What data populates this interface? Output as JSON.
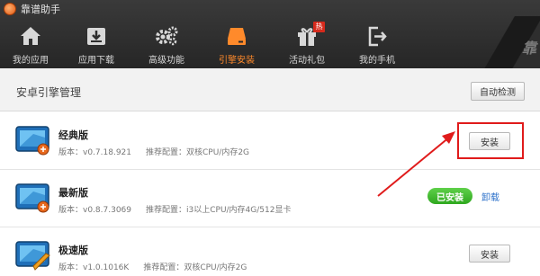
{
  "app": {
    "title": "靠谱助手",
    "corner_text": "靠"
  },
  "nav": {
    "items": [
      {
        "label": "我的应用",
        "icon": "home-icon"
      },
      {
        "label": "应用下载",
        "icon": "download-box-icon"
      },
      {
        "label": "高级功能",
        "icon": "gears-icon"
      },
      {
        "label": "引擎安装",
        "icon": "engine-disk-icon",
        "active": true
      },
      {
        "label": "活动礼包",
        "icon": "gift-icon",
        "badge": "热"
      },
      {
        "label": "我的手机",
        "icon": "phone-exit-icon"
      }
    ]
  },
  "section": {
    "title": "安卓引擎管理",
    "auto_detect_label": "自动检测"
  },
  "engines": [
    {
      "name": "经典版",
      "version": "版本：v0.7.18.921",
      "recommend": "推荐配置：双核CPU/内存2G",
      "action": "安装"
    },
    {
      "name": "最新版",
      "version": "版本：v0.8.7.3069",
      "recommend": "推荐配置：i3以上CPU/内存4G/512显卡",
      "status": "已安装",
      "uninstall": "卸载"
    },
    {
      "name": "极速版",
      "version": "版本：v1.0.1016K",
      "recommend": "推荐配置：双核CPU/内存2G",
      "action": "安装"
    }
  ],
  "colors": {
    "accent": "#ff8a2b",
    "highlight": "#e01b1b",
    "installed": "#3cb22a",
    "link": "#2a6fc9"
  }
}
